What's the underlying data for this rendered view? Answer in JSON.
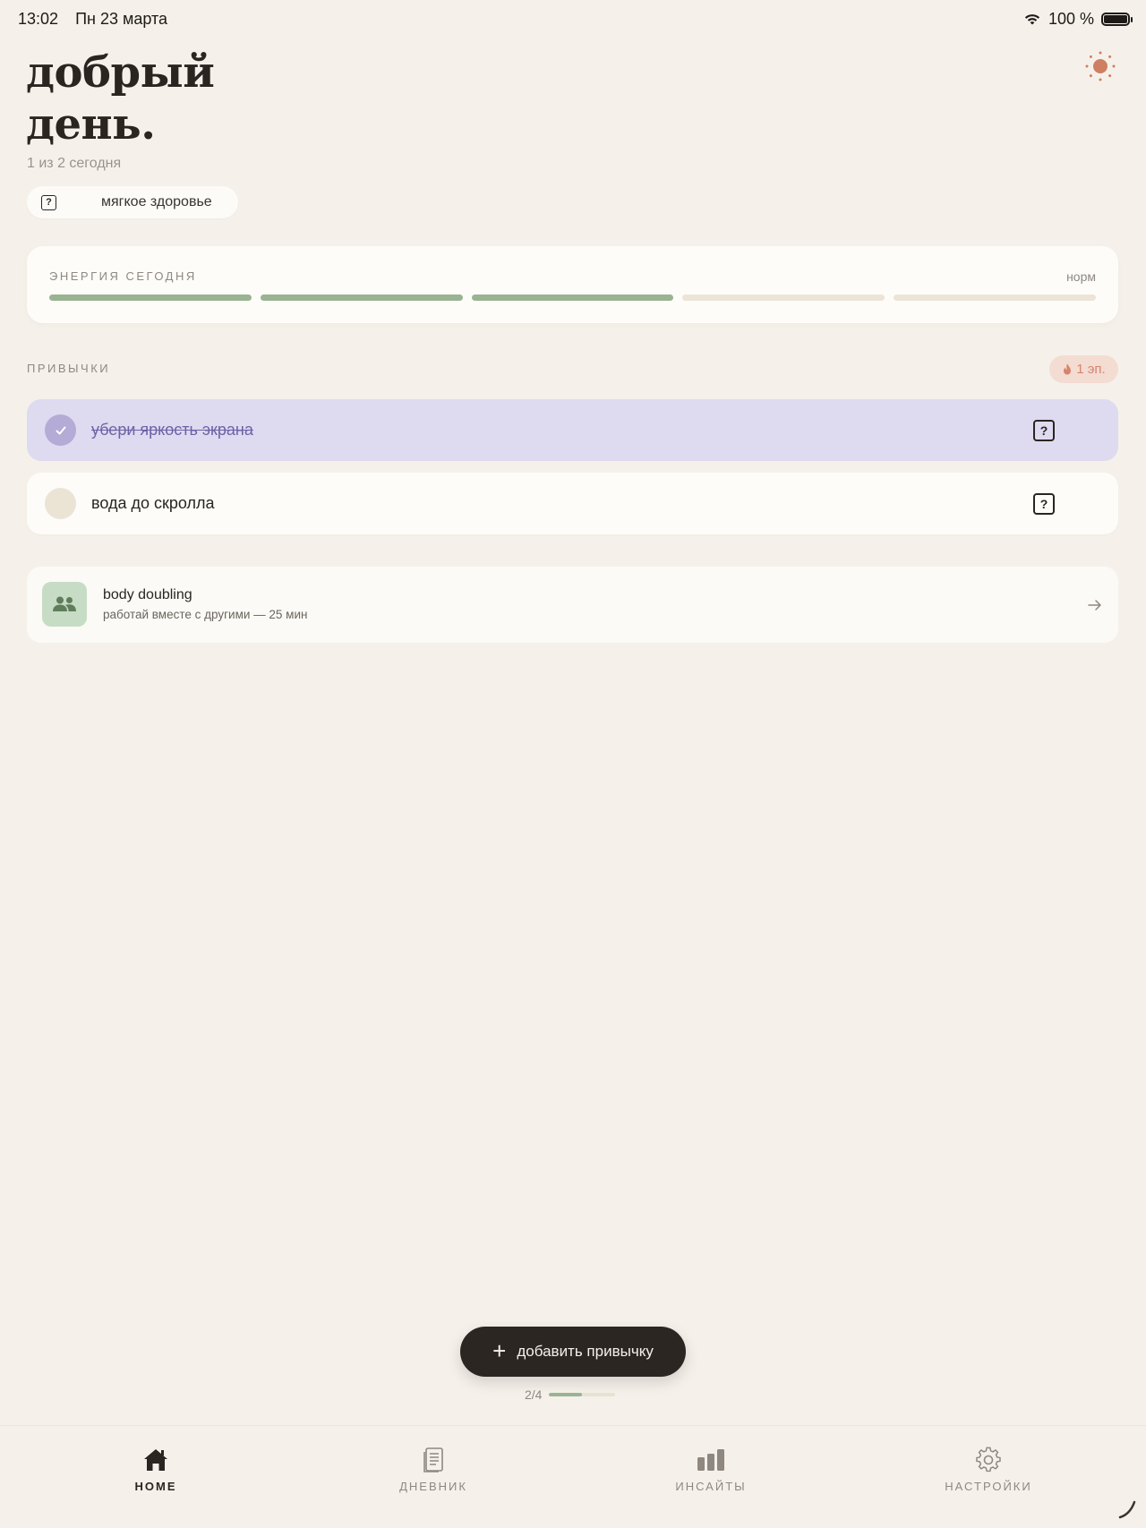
{
  "status_bar": {
    "time": "13:02",
    "date": "Пн 23 марта",
    "battery": "100 %"
  },
  "header": {
    "greeting_line1": "добрый",
    "greeting_line2": "день.",
    "subtitle": "1 из 2 сегодня",
    "mode_chip": "мягкое здоровье",
    "theme_icon": "sun-icon"
  },
  "energy": {
    "title": "ЭНЕРГИЯ СЕГОДНЯ",
    "value_label": "норм",
    "level": 3,
    "max": 5
  },
  "habits": {
    "title": "ПРИВЫЧКИ",
    "streak": "1 эп.",
    "items": [
      {
        "label": "убери яркость экрана",
        "done": true
      },
      {
        "label": "вода до скролла",
        "done": false
      }
    ]
  },
  "body_doubling": {
    "title": "body doubling",
    "subtitle": "работай вместе с другими — 25 мин"
  },
  "fab": {
    "label": "добавить привычку"
  },
  "progress": {
    "text": "2/4",
    "fraction": 0.5
  },
  "tabs": [
    {
      "label": "HOME",
      "icon": "home-icon",
      "active": true
    },
    {
      "label": "ДНЕВНИК",
      "icon": "journal-icon",
      "active": false
    },
    {
      "label": "ИНСАЙТЫ",
      "icon": "bar-chart-icon",
      "active": false
    },
    {
      "label": "НАСТРОЙКИ",
      "icon": "gear-icon",
      "active": false
    }
  ],
  "colors": {
    "background": "#f5f1ea",
    "energy_on": "#9ab393",
    "energy_off": "#ece4d6",
    "done_habit": "#dedaf0",
    "accent_sun": "#d07e62",
    "fab": "#2b2622"
  }
}
